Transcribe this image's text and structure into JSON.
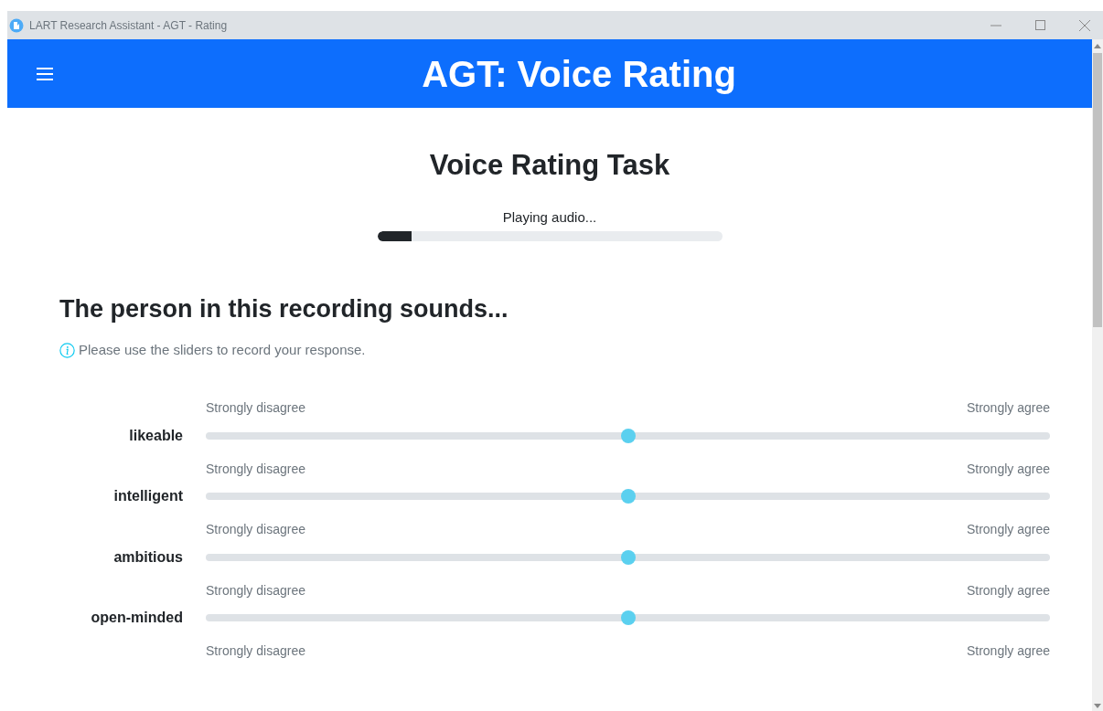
{
  "window": {
    "title": "LART Research Assistant - AGT - Rating"
  },
  "header": {
    "title": "AGT: Voice Rating"
  },
  "task": {
    "title": "Voice Rating Task",
    "status": "Playing audio...",
    "progress": {
      "level": 0.1
    }
  },
  "question": {
    "heading": "The person in this recording sounds...",
    "hint": "Please use the sliders to record your response."
  },
  "ratings": [
    {
      "kind": "slider",
      "min_label": "Strongly disagree",
      "max_label": "Strongly agree",
      "trait": "likeable",
      "level": 0.5
    },
    {
      "kind": "slider",
      "min_label": "Strongly disagree",
      "max_label": "Strongly agree",
      "trait": "intelligent",
      "level": 0.5
    },
    {
      "kind": "slider",
      "min_label": "Strongly disagree",
      "max_label": "Strongly agree",
      "trait": "ambitious",
      "level": 0.5
    },
    {
      "kind": "slider",
      "min_label": "Strongly disagree",
      "max_label": "Strongly agree",
      "trait": "open-minded",
      "level": 0.5
    },
    {
      "kind": "labels",
      "min_label": "Strongly disagree",
      "max_label": "Strongly agree"
    }
  ]
}
